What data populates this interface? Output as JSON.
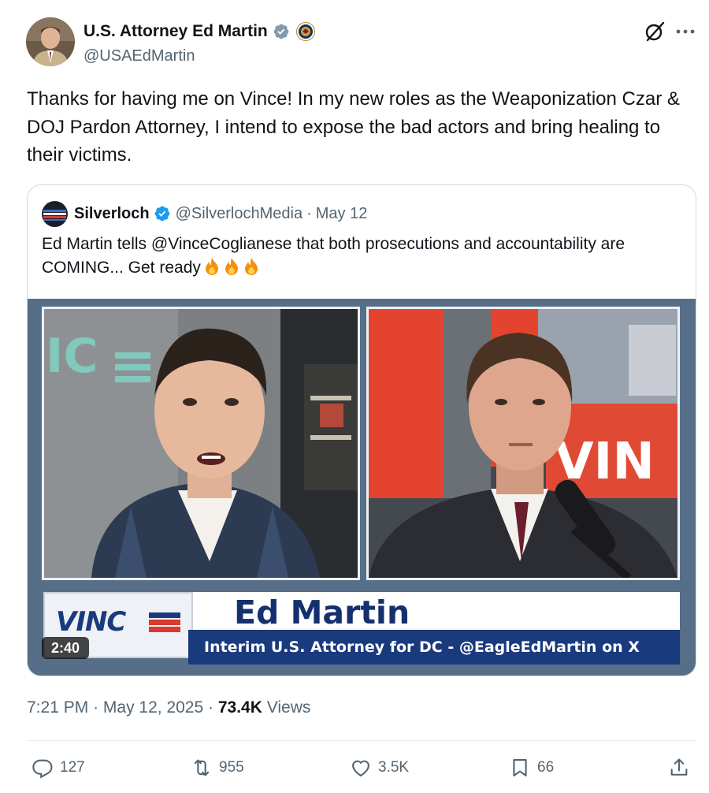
{
  "author": {
    "display_name": "U.S. Attorney Ed Martin",
    "handle": "@USAEdMartin"
  },
  "icons": {
    "verified": "verified-badge-icon",
    "affiliation": "doj-seal-icon",
    "grok": "grok-icon",
    "more": "more-icon",
    "reply": "reply-icon",
    "repost": "repost-icon",
    "like": "like-icon",
    "bookmark": "bookmark-icon",
    "share": "share-icon"
  },
  "colors": {
    "verified_blue": "#1d9bf0",
    "text_primary": "#0f1419",
    "text_secondary": "#536471",
    "border": "#cfd9de"
  },
  "tweet": {
    "text": "Thanks for having me on Vince! In my new roles as the Weaponization Czar & DOJ Pardon Attorney, I intend to expose the bad actors and bring healing to their victims."
  },
  "quote": {
    "display_name": "Silverloch",
    "handle": "@SilverlochMedia",
    "separator": "·",
    "date": "May 12",
    "text": "Ed Martin tells @VinceCoglianese that both prosecutions and accountability are COMING... Get ready",
    "emoji": [
      "fire",
      "fire",
      "fire"
    ],
    "video": {
      "logo_text": "VINC",
      "lower_third_name": "Ed Martin",
      "lower_third_title": "Interim U.S. Attorney for DC - @EagleEdMartin on X",
      "duration": "2:40"
    }
  },
  "meta": {
    "time": "7:21 PM",
    "separator": "·",
    "date": "May 12, 2025",
    "views_count": "73.4K",
    "views_label": "Views"
  },
  "actions": {
    "replies": "127",
    "reposts": "955",
    "likes": "3.5K",
    "bookmarks": "66"
  }
}
